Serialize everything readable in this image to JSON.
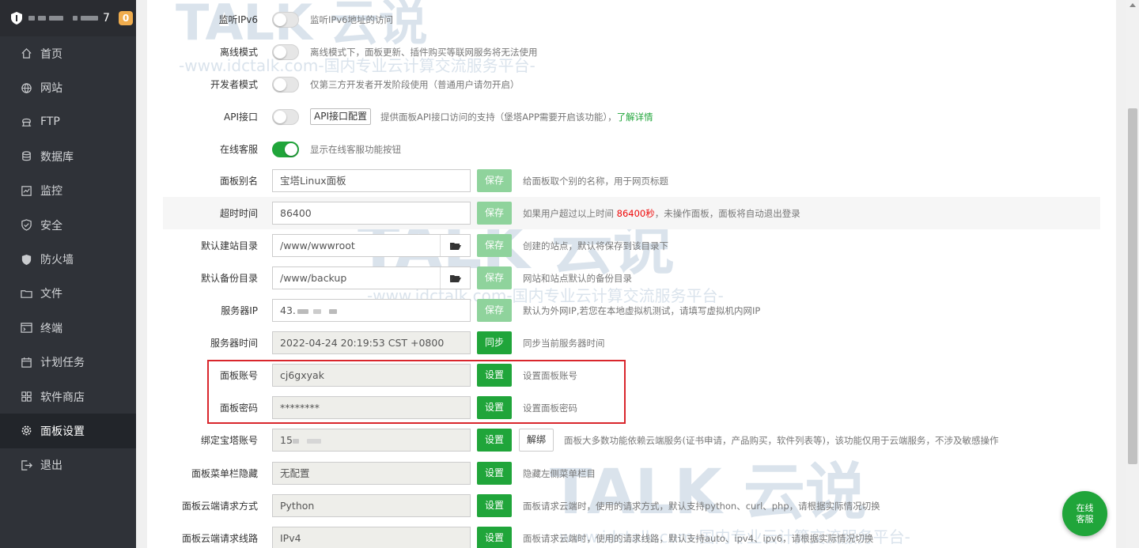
{
  "sidebar": {
    "host_tail": "7",
    "badge": "0",
    "items": [
      {
        "label": "首页",
        "icon": "home-icon"
      },
      {
        "label": "网站",
        "icon": "globe-icon"
      },
      {
        "label": "FTP",
        "icon": "ftp-icon"
      },
      {
        "label": "数据库",
        "icon": "database-icon"
      },
      {
        "label": "监控",
        "icon": "monitor-icon"
      },
      {
        "label": "安全",
        "icon": "shield-check-icon"
      },
      {
        "label": "防火墙",
        "icon": "firewall-icon"
      },
      {
        "label": "文件",
        "icon": "folder-icon"
      },
      {
        "label": "终端",
        "icon": "terminal-icon"
      },
      {
        "label": "计划任务",
        "icon": "calendar-icon"
      },
      {
        "label": "软件商店",
        "icon": "grid-icon"
      },
      {
        "label": "面板设置",
        "icon": "gear-icon"
      },
      {
        "label": "退出",
        "icon": "logout-icon"
      }
    ],
    "active": "面板设置"
  },
  "settings": {
    "ipv6": {
      "label": "监听IPv6",
      "hint": "监听IPv6地址的访问",
      "on": false
    },
    "offline": {
      "label": "离线模式",
      "hint": "离线模式下，面板更新、插件购买等联网服务将无法使用",
      "on": false
    },
    "dev": {
      "label": "开发者模式",
      "hint": "仅第三方开发者开发阶段使用（普通用户请勿开启）",
      "on": false
    },
    "api": {
      "label": "API接口",
      "button": "API接口配置",
      "hint": "提供面板API接口访问的支持（堡塔APP需要开启该功能），",
      "link": "了解详情",
      "on": false
    },
    "online_service": {
      "label": "在线客服",
      "hint": "显示在线客服功能按钮",
      "on": true
    },
    "alias": {
      "label": "面板别名",
      "value": "宝塔Linux面板",
      "button": "保存",
      "hint": "给面板取个别的名称，用于网页标题"
    },
    "timeout": {
      "label": "超时时间",
      "value": "86400",
      "button": "保存",
      "hint_prefix": "如果用户超过以上时间 ",
      "hint_red": "86400秒",
      "hint_suffix": "，未操作面板，面板将自动退出登录"
    },
    "site_dir": {
      "label": "默认建站目录",
      "value": "/www/wwwroot",
      "button": "保存",
      "hint": "创建的站点，默认将保存到该目录下"
    },
    "backup_dir": {
      "label": "默认备份目录",
      "value": "/www/backup",
      "button": "保存",
      "hint": "网站和站点默认的备份目录"
    },
    "server_ip": {
      "label": "服务器IP",
      "value_prefix": "43.",
      "button": "保存",
      "hint": "默认为外网IP,若您在本地虚拟机测试，请填写虚拟机内网IP"
    },
    "server_time": {
      "label": "服务器时间",
      "value": "2022-04-24 20:19:53 CST +0800",
      "button": "同步",
      "hint": "同步当前服务器时间"
    },
    "account": {
      "label": "面板账号",
      "value": "cj6gxyak",
      "button": "设置",
      "hint": "设置面板账号"
    },
    "password": {
      "label": "面板密码",
      "value": "********",
      "button": "设置",
      "hint": "设置面板密码"
    },
    "bt_account": {
      "label": "绑定宝塔账号",
      "value_prefix": "15",
      "button": "设置",
      "button2": "解绑",
      "hint": "面板大多数功能依赖云端服务(证书申请，产品购买，软件列表等)，该功能仅用于云端服务，不涉及敏感操作"
    },
    "menu_hide": {
      "label": "面板菜单栏隐藏",
      "value": "无配置",
      "button": "设置",
      "hint": "隐藏左侧菜单栏目"
    },
    "req_method": {
      "label": "面板云端请求方式",
      "value": "Python",
      "button": "设置",
      "hint": "面板请求云端时，使用的请求方式，默认支持python、curl、php，请根据实际情况切换"
    },
    "req_line": {
      "label": "面板云端请求线路",
      "value": "IPv4",
      "button": "设置",
      "hint": "面板请求云端时，使用的请求线路，默认支持auto、ipv4、ipv6，请根据实际情况切换"
    }
  },
  "watermark": {
    "brand": "TALK 云说",
    "url": "-www.idctalk.com-国内专业云计算交流服务平台-"
  },
  "chat": {
    "line1": "在线",
    "line2": "客服"
  },
  "colors": {
    "accent": "#20a53a",
    "sidebar": "#2f3238",
    "red": "#ef0808"
  }
}
